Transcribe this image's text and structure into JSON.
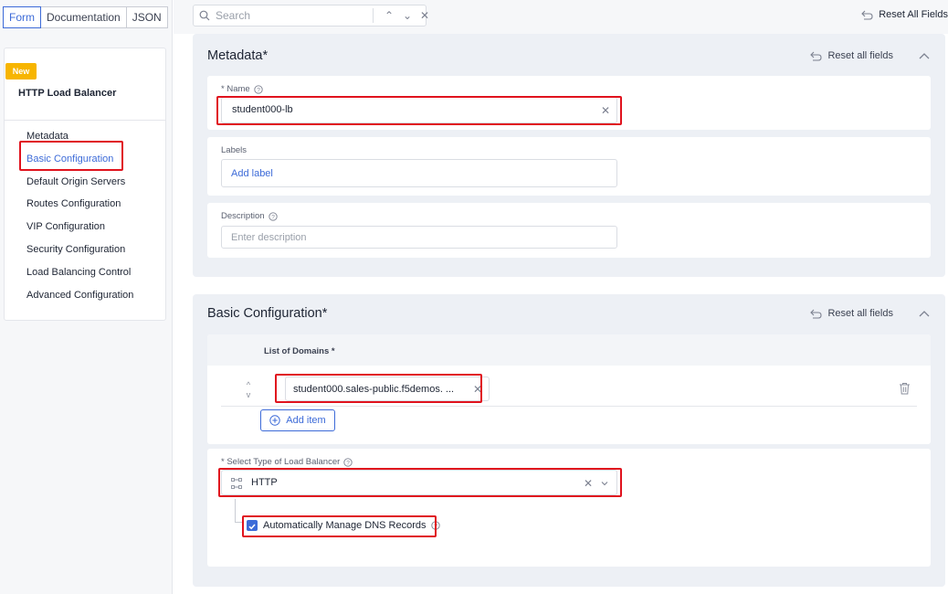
{
  "mode_tabs": [
    "Form",
    "Documentation",
    "JSON"
  ],
  "nav": {
    "badge": "New",
    "title": "HTTP Load Balancer",
    "items": [
      {
        "label": "Metadata"
      },
      {
        "label": "Basic Configuration"
      },
      {
        "label": "Default Origin Servers"
      },
      {
        "label": "Routes Configuration"
      },
      {
        "label": "VIP Configuration"
      },
      {
        "label": "Security Configuration"
      },
      {
        "label": "Load Balancing Control"
      },
      {
        "label": "Advanced Configuration"
      }
    ],
    "active_index": 1
  },
  "topbar": {
    "search_placeholder": "Search",
    "reset_all_label": "Reset All Fields"
  },
  "metadata": {
    "title": "Metadata",
    "required_mark": "*",
    "reset_label": "Reset all fields",
    "name": {
      "label": "* Name",
      "value": "student000-lb"
    },
    "labels": {
      "label": "Labels",
      "add_label": "Add label"
    },
    "description": {
      "label": "Description",
      "placeholder": "Enter description"
    }
  },
  "basic": {
    "title": "Basic Configuration",
    "required_mark": "*",
    "reset_label": "Reset all fields",
    "domains": {
      "header": "List of Domains *",
      "items": [
        "student000.sales-public.f5demos. ..."
      ],
      "add_item_label": "Add item"
    },
    "lb_type": {
      "label": "* Select Type of Load Balancer",
      "value": "HTTP"
    },
    "dns": {
      "label": "Automatically Manage DNS Records",
      "checked": true
    }
  },
  "colors": {
    "accent": "#3d6bd8",
    "highlight": "#e0131e",
    "badge": "#f7b500",
    "section_bg": "#edf0f5"
  }
}
